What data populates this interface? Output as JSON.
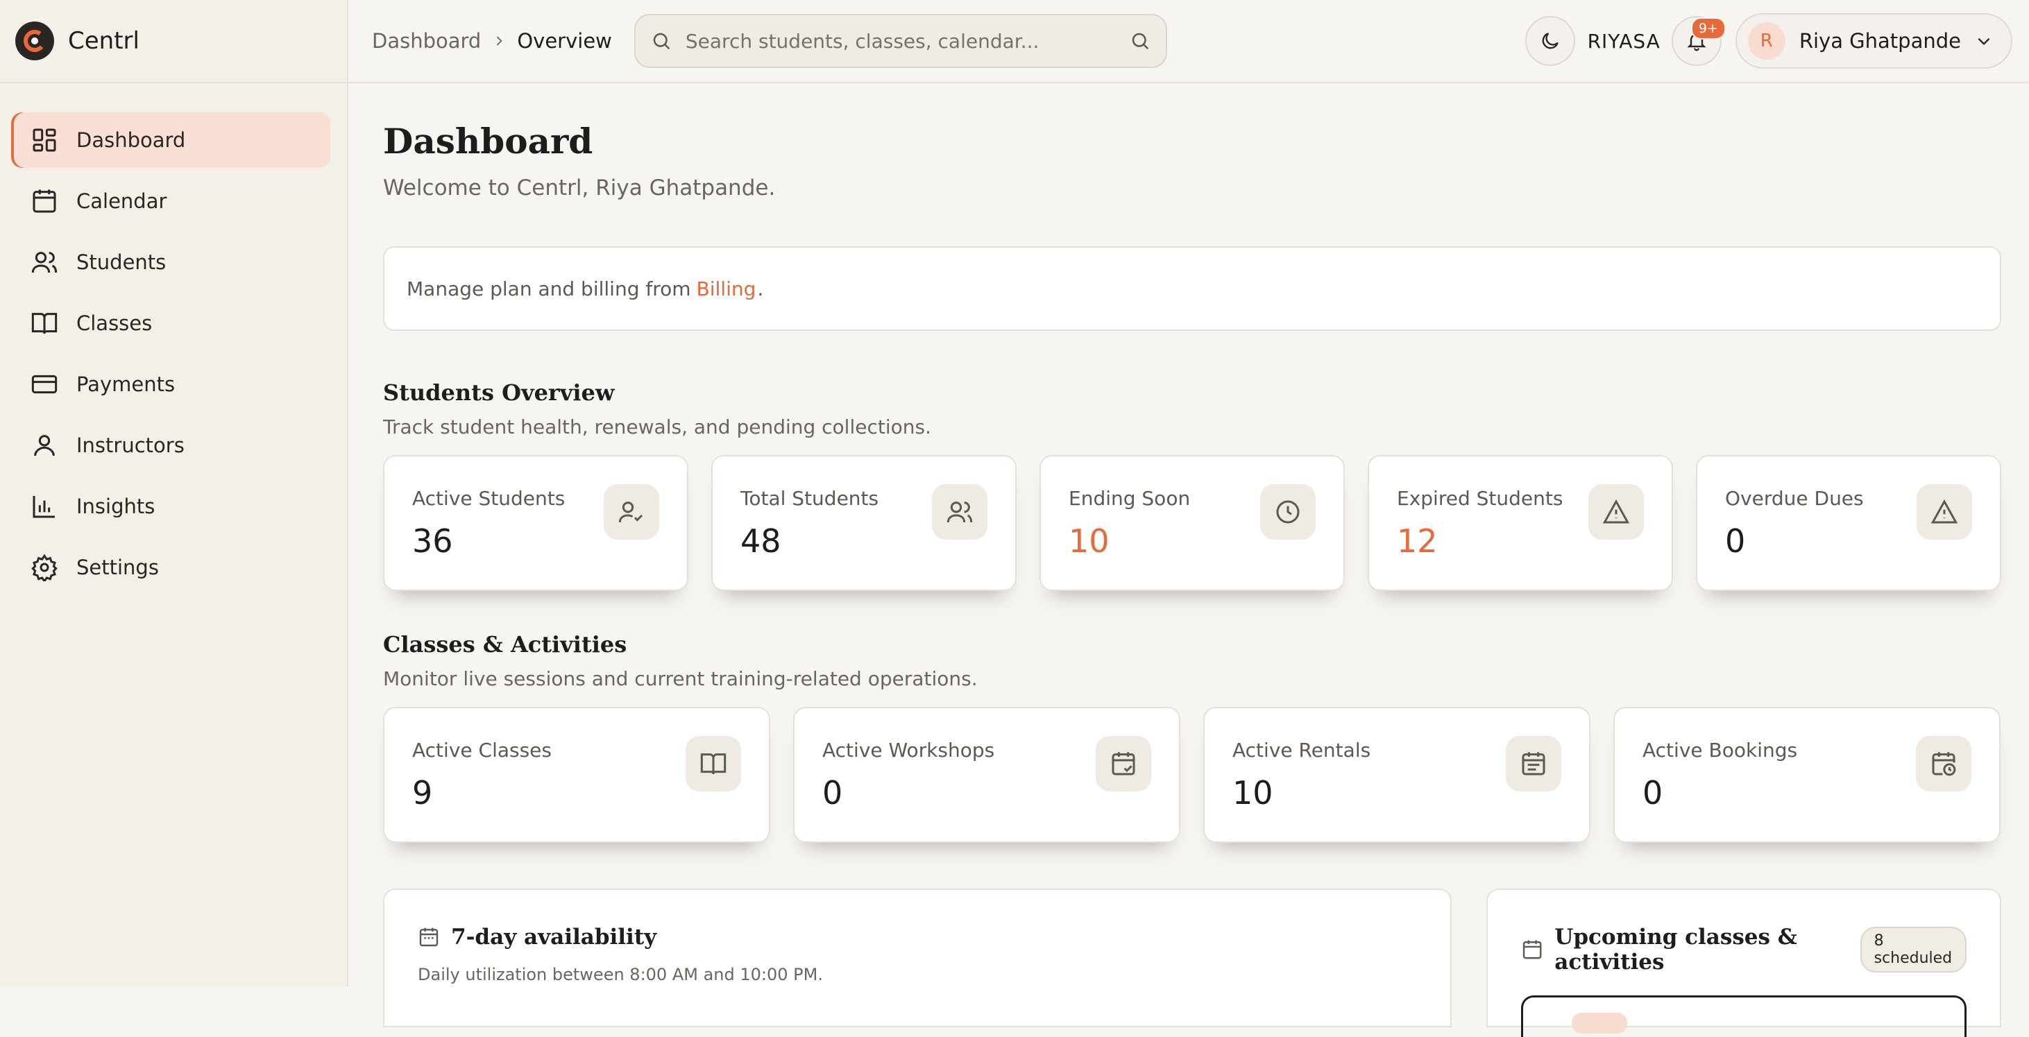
{
  "brand": {
    "name": "Centrl"
  },
  "sidebar": {
    "items": [
      {
        "label": "Dashboard",
        "icon": "dashboard-icon",
        "active": true
      },
      {
        "label": "Calendar",
        "icon": "calendar-icon"
      },
      {
        "label": "Students",
        "icon": "users-icon"
      },
      {
        "label": "Classes",
        "icon": "book-icon"
      },
      {
        "label": "Payments",
        "icon": "credit-card-icon"
      },
      {
        "label": "Instructors",
        "icon": "user-icon"
      },
      {
        "label": "Insights",
        "icon": "bar-chart-icon"
      },
      {
        "label": "Settings",
        "icon": "gear-icon"
      }
    ]
  },
  "topbar": {
    "breadcrumb": [
      "Dashboard",
      "Overview"
    ],
    "search_placeholder": "Search students, classes, calendar...",
    "org_code": "RIYASA",
    "notification_count": "9+",
    "user": {
      "initial": "R",
      "name": "Riya Ghatpande"
    }
  },
  "main": {
    "title": "Dashboard",
    "welcome": "Welcome to Centrl, Riya Ghatpande.",
    "billing": {
      "text": "Manage plan and billing from",
      "link": "Billing",
      "suffix": "."
    },
    "students_overview": {
      "title": "Students Overview",
      "subtitle": "Track student health, renewals, and pending collections.",
      "cards": [
        {
          "label": "Active Students",
          "value": "36",
          "icon": "user-check-icon"
        },
        {
          "label": "Total Students",
          "value": "48",
          "icon": "users-icon"
        },
        {
          "label": "Ending Soon",
          "value": "10",
          "icon": "clock-icon",
          "accent": true
        },
        {
          "label": "Expired Students",
          "value": "12",
          "icon": "alert-triangle-icon",
          "accent": true
        },
        {
          "label": "Overdue Dues",
          "value": "0",
          "icon": "alert-triangle-icon"
        }
      ]
    },
    "classes_activities": {
      "title": "Classes & Activities",
      "subtitle": "Monitor live sessions and current training-related operations.",
      "cards": [
        {
          "label": "Active Classes",
          "value": "9",
          "icon": "book-icon"
        },
        {
          "label": "Active Workshops",
          "value": "0",
          "icon": "calendar-check-icon"
        },
        {
          "label": "Active Rentals",
          "value": "10",
          "icon": "calendar-list-icon"
        },
        {
          "label": "Active Bookings",
          "value": "0",
          "icon": "calendar-clock-icon"
        }
      ]
    },
    "availability": {
      "title": "7-day availability",
      "subtitle": "Daily utilization between 8:00 AM and 10:00 PM."
    },
    "upcoming": {
      "title": "Upcoming classes & activities",
      "badge": "8 scheduled"
    }
  },
  "colors": {
    "accent": "#e8693a",
    "active_bg": "#f9dfd4",
    "sidebar_bg": "#f3efe9"
  }
}
